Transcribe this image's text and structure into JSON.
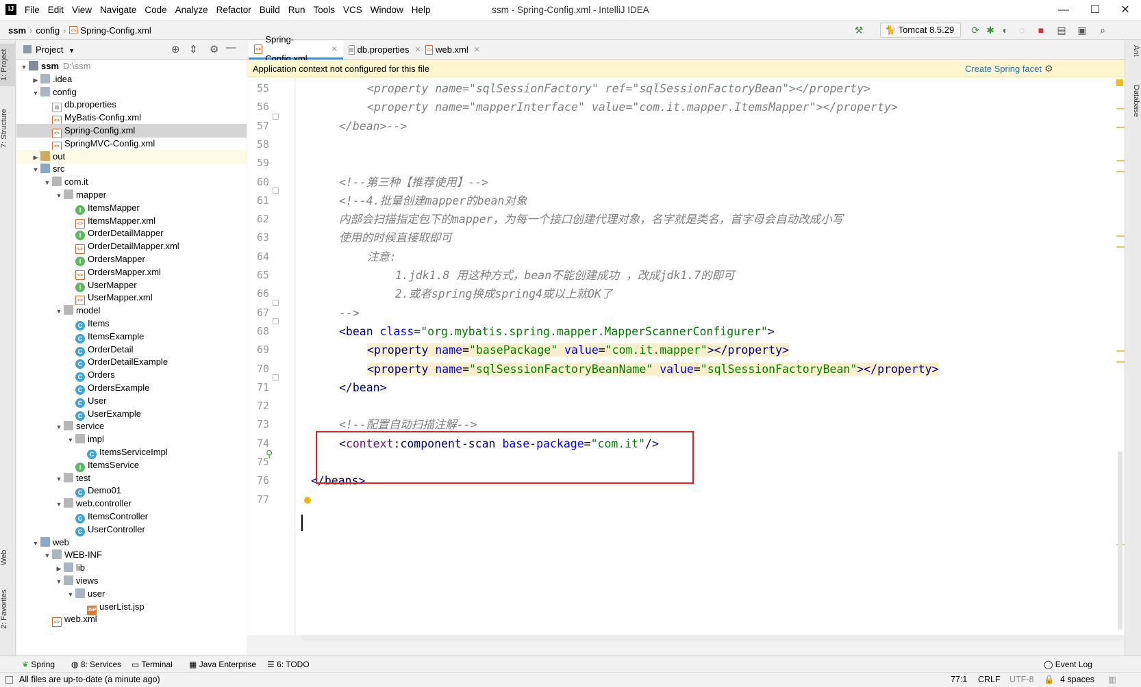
{
  "window": {
    "title": "ssm - Spring-Config.xml - IntelliJ IDEA",
    "logo": "IJ"
  },
  "menu": [
    "File",
    "Edit",
    "View",
    "Navigate",
    "Code",
    "Analyze",
    "Refactor",
    "Build",
    "Run",
    "Tools",
    "VCS",
    "Window",
    "Help"
  ],
  "breadcrumb": [
    "ssm",
    "config",
    "Spring-Config.xml"
  ],
  "run_config": "Tomcat 8.5.29",
  "tool_windows_left": [
    "1: Project",
    "7: Structure",
    "Web",
    "2: Favorites"
  ],
  "tool_windows_right": [
    "Ant",
    "Database"
  ],
  "project_panel": {
    "title": "Project"
  },
  "tree": [
    {
      "label": "ssm",
      "extra": "D:\\ssm",
      "level": 0,
      "arrow": "▼",
      "icon": "proj",
      "bold": true
    },
    {
      "label": ".idea",
      "level": 1,
      "arrow": "▶",
      "icon": "folder"
    },
    {
      "label": "config",
      "level": 1,
      "arrow": "▼",
      "icon": "folder"
    },
    {
      "label": "db.properties",
      "level": 2,
      "arrow": "",
      "icon": "prop"
    },
    {
      "label": "MyBatis-Config.xml",
      "level": 2,
      "arrow": "",
      "icon": "xml"
    },
    {
      "label": "Spring-Config.xml",
      "level": 2,
      "arrow": "",
      "icon": "xml",
      "selected": true
    },
    {
      "label": "SpringMVC-Config.xml",
      "level": 2,
      "arrow": "",
      "icon": "xml"
    },
    {
      "label": "out",
      "level": 1,
      "arrow": "▶",
      "icon": "folderor",
      "highlight": true
    },
    {
      "label": "src",
      "level": 1,
      "arrow": "▼",
      "icon": "folderb"
    },
    {
      "label": "com.it",
      "level": 2,
      "arrow": "▼",
      "icon": "pkg"
    },
    {
      "label": "mapper",
      "level": 3,
      "arrow": "▼",
      "icon": "pkg"
    },
    {
      "label": "ItemsMapper",
      "level": 4,
      "arrow": "",
      "icon": "ci"
    },
    {
      "label": "ItemsMapper.xml",
      "level": 4,
      "arrow": "",
      "icon": "xml"
    },
    {
      "label": "OrderDetailMapper",
      "level": 4,
      "arrow": "",
      "icon": "ci"
    },
    {
      "label": "OrderDetailMapper.xml",
      "level": 4,
      "arrow": "",
      "icon": "xml"
    },
    {
      "label": "OrdersMapper",
      "level": 4,
      "arrow": "",
      "icon": "ci"
    },
    {
      "label": "OrdersMapper.xml",
      "level": 4,
      "arrow": "",
      "icon": "xml"
    },
    {
      "label": "UserMapper",
      "level": 4,
      "arrow": "",
      "icon": "ci"
    },
    {
      "label": "UserMapper.xml",
      "level": 4,
      "arrow": "",
      "icon": "xml"
    },
    {
      "label": "model",
      "level": 3,
      "arrow": "▼",
      "icon": "pkg"
    },
    {
      "label": "Items",
      "level": 4,
      "arrow": "",
      "icon": "cc"
    },
    {
      "label": "ItemsExample",
      "level": 4,
      "arrow": "",
      "icon": "cc"
    },
    {
      "label": "OrderDetail",
      "level": 4,
      "arrow": "",
      "icon": "cc"
    },
    {
      "label": "OrderDetailExample",
      "level": 4,
      "arrow": "",
      "icon": "cc"
    },
    {
      "label": "Orders",
      "level": 4,
      "arrow": "",
      "icon": "cc"
    },
    {
      "label": "OrdersExample",
      "level": 4,
      "arrow": "",
      "icon": "cc"
    },
    {
      "label": "User",
      "level": 4,
      "arrow": "",
      "icon": "cc"
    },
    {
      "label": "UserExample",
      "level": 4,
      "arrow": "",
      "icon": "cc"
    },
    {
      "label": "service",
      "level": 3,
      "arrow": "▼",
      "icon": "pkg"
    },
    {
      "label": "impl",
      "level": 4,
      "arrow": "▼",
      "icon": "pkg"
    },
    {
      "label": "ItemsServiceImpl",
      "level": 5,
      "arrow": "",
      "icon": "cc"
    },
    {
      "label": "ItemsService",
      "level": 4,
      "arrow": "",
      "icon": "ci"
    },
    {
      "label": "test",
      "level": 3,
      "arrow": "▼",
      "icon": "pkg"
    },
    {
      "label": "Demo01",
      "level": 4,
      "arrow": "",
      "icon": "cc"
    },
    {
      "label": "web.controller",
      "level": 3,
      "arrow": "▼",
      "icon": "pkg"
    },
    {
      "label": "ItemsController",
      "level": 4,
      "arrow": "",
      "icon": "cc"
    },
    {
      "label": "UserController",
      "level": 4,
      "arrow": "",
      "icon": "cc"
    },
    {
      "label": "web",
      "level": 1,
      "arrow": "▼",
      "icon": "folderb"
    },
    {
      "label": "WEB-INF",
      "level": 2,
      "arrow": "▼",
      "icon": "folder"
    },
    {
      "label": "lib",
      "level": 3,
      "arrow": "▶",
      "icon": "folder"
    },
    {
      "label": "views",
      "level": 3,
      "arrow": "▼",
      "icon": "folder"
    },
    {
      "label": "user",
      "level": 4,
      "arrow": "▼",
      "icon": "folder"
    },
    {
      "label": "userList.jsp",
      "level": 5,
      "arrow": "",
      "icon": "jsp"
    },
    {
      "label": "web.xml",
      "level": 2,
      "arrow": "",
      "icon": "xml"
    }
  ],
  "tabs": [
    {
      "label": "Spring-Config.xml",
      "icon": "xml",
      "active": true
    },
    {
      "label": "db.properties",
      "icon": "prop",
      "active": false
    },
    {
      "label": "web.xml",
      "icon": "xml",
      "active": false
    }
  ],
  "banner": {
    "message": "Application context not configured for this file",
    "action": "Create Spring facet"
  },
  "code": [
    {
      "n": "55",
      "indent": 2,
      "parts": [
        {
          "c": "cm",
          "t": "<property name=\"sqlSessionFactory\" ref=\"sqlSessionFactoryBean\"></property>"
        }
      ]
    },
    {
      "n": "56",
      "indent": 2,
      "parts": [
        {
          "c": "cm",
          "t": "<property name=\"mapperInterface\" value=\"com.it.mapper.ItemsMapper\"></property>"
        }
      ]
    },
    {
      "n": "57",
      "indent": 1,
      "parts": [
        {
          "c": "cm",
          "t": "</bean>-->"
        }
      ]
    },
    {
      "n": "58",
      "indent": 0,
      "parts": []
    },
    {
      "n": "59",
      "indent": 0,
      "parts": []
    },
    {
      "n": "60",
      "indent": 1,
      "parts": [
        {
          "c": "cm",
          "t": "<!--第三种【推荐使用】-->"
        }
      ]
    },
    {
      "n": "61",
      "indent": 1,
      "parts": [
        {
          "c": "cm",
          "t": "<!--4.批量创建mapper的bean对象"
        }
      ]
    },
    {
      "n": "62",
      "indent": 1,
      "parts": [
        {
          "c": "cm",
          "t": "内部会扫描指定包下的mapper，为每一个接口创建代理对象，名字就是类名，首字母会自动改成小写"
        }
      ]
    },
    {
      "n": "63",
      "indent": 1,
      "parts": [
        {
          "c": "cm",
          "t": "使用的时候直接取即可"
        }
      ]
    },
    {
      "n": "64",
      "indent": 2,
      "parts": [
        {
          "c": "cm",
          "t": "注意:"
        }
      ]
    },
    {
      "n": "65",
      "indent": 3,
      "parts": [
        {
          "c": "cm",
          "t": "1.jdk1.8 用这种方式，bean不能创建成功 ，改成jdk1.7的即可"
        }
      ]
    },
    {
      "n": "66",
      "indent": 3,
      "parts": [
        {
          "c": "cm",
          "t": "2.或者spring换成spring4或以上就OK了"
        }
      ]
    },
    {
      "n": "67",
      "indent": 1,
      "parts": [
        {
          "c": "cm",
          "t": "-->"
        }
      ]
    },
    {
      "n": "68",
      "indent": 1,
      "parts": [
        {
          "c": "tg",
          "t": "<bean "
        },
        {
          "c": "at",
          "t": "class"
        },
        {
          "c": "pl",
          "t": "="
        },
        {
          "c": "st",
          "t": "\"org.mybatis.spring.mapper.MapperScannerConfigurer\""
        },
        {
          "c": "tg",
          "t": ">"
        }
      ]
    },
    {
      "n": "69",
      "indent": 2,
      "hl": true,
      "parts": [
        {
          "c": "tg",
          "t": "<property "
        },
        {
          "c": "at",
          "t": "name"
        },
        {
          "c": "pl",
          "t": "="
        },
        {
          "c": "st",
          "t": "\"basePackage\" "
        },
        {
          "c": "at",
          "t": "value"
        },
        {
          "c": "pl",
          "t": "="
        },
        {
          "c": "st",
          "t": "\"com.it.mapper\""
        },
        {
          "c": "tg",
          "t": "></property>"
        }
      ]
    },
    {
      "n": "70",
      "indent": 2,
      "hl": true,
      "parts": [
        {
          "c": "tg",
          "t": "<property "
        },
        {
          "c": "at",
          "t": "name"
        },
        {
          "c": "pl",
          "t": "="
        },
        {
          "c": "st",
          "t": "\"sqlSessionFactoryBeanName\" "
        },
        {
          "c": "at",
          "t": "value"
        },
        {
          "c": "pl",
          "t": "="
        },
        {
          "c": "st",
          "t": "\"sqlSessionFactoryBean\""
        },
        {
          "c": "tg",
          "t": "></property>"
        }
      ]
    },
    {
      "n": "71",
      "indent": 1,
      "parts": [
        {
          "c": "tg",
          "t": "</bean>"
        }
      ]
    },
    {
      "n": "72",
      "indent": 0,
      "parts": []
    },
    {
      "n": "73",
      "indent": 1,
      "parts": [
        {
          "c": "cm",
          "t": "<!--配置自动扫描注解-->"
        }
      ]
    },
    {
      "n": "74",
      "indent": 1,
      "parts": [
        {
          "c": "tg",
          "t": "<"
        },
        {
          "c": "ns",
          "t": "context"
        },
        {
          "c": "tg",
          "t": ":component-scan "
        },
        {
          "c": "at",
          "t": "base-package"
        },
        {
          "c": "pl",
          "t": "="
        },
        {
          "c": "st",
          "t": "\"com.it\""
        },
        {
          "c": "tg",
          "t": "/>"
        }
      ]
    },
    {
      "n": "75",
      "indent": 0,
      "parts": []
    },
    {
      "n": "76",
      "indent": 0,
      "parts": [
        {
          "c": "tg",
          "t": "</beans>"
        }
      ]
    },
    {
      "n": "77",
      "indent": 0,
      "parts": []
    }
  ],
  "bottom_tools": [
    "Spring",
    "8: Services",
    "Terminal",
    "Java Enterprise",
    "6: TODO",
    "Event Log"
  ],
  "status": {
    "message": "All files are up-to-date (a minute ago)",
    "position": "77:1",
    "line_sep": "CRLF",
    "encoding": "UTF-8",
    "indent": "4 spaces"
  },
  "colors": {
    "accent": "#4a88c7",
    "banner": "#fdf6cf",
    "highlight_box": "#e02020"
  }
}
